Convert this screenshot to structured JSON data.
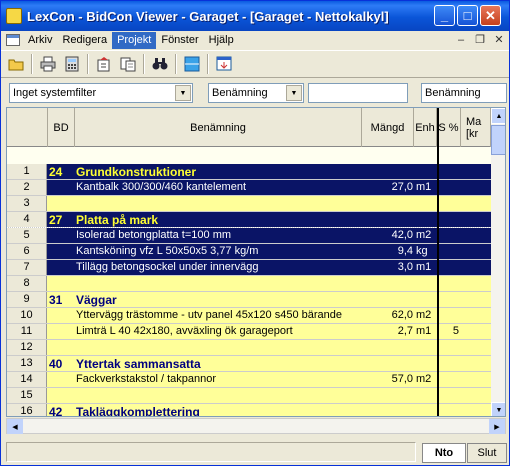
{
  "window": {
    "title": "LexCon - BidCon Viewer - Garaget - [Garaget - Nettokalkyl]",
    "min": "0",
    "max": "1",
    "close": "r"
  },
  "menu": [
    "Arkiv",
    "Redigera",
    "Projekt",
    "Fönster",
    "Hjälp"
  ],
  "menu_active": "Projekt",
  "mdi": {
    "min": "–",
    "restore": "❐",
    "close": "✕"
  },
  "toolbar": [
    "open-folder-icon",
    "print-icon",
    "calculator-icon",
    "export-icon",
    "copy-icon",
    "binoculars-icon",
    "layout-icon",
    "window-icon"
  ],
  "filter": {
    "system": "Inget systemfilter",
    "sort": "Benämning",
    "search": "",
    "column": "Benämning"
  },
  "columns": {
    "bd": "BD",
    "benamning": "Benämning",
    "mangd": "Mängd",
    "enh": "Enh",
    "spct": "S %",
    "ma_line1": "Ma",
    "ma_line2": "[kr"
  },
  "rows": [
    {
      "n": "1",
      "bd": "24",
      "text": "Grundkonstruktioner",
      "mangd": "",
      "enh": "",
      "s": "",
      "type": "group"
    },
    {
      "n": "2",
      "bd": "",
      "text": "Kantbalk 300/300/460 kantelement",
      "mangd": "27,0",
      "enh": "m1",
      "s": "",
      "type": "hilite"
    },
    {
      "n": "3",
      "bd": "",
      "text": "",
      "mangd": "",
      "enh": "",
      "s": "",
      "type": "item"
    },
    {
      "n": "4",
      "bd": "27",
      "text": "Platta på mark",
      "mangd": "",
      "enh": "",
      "s": "",
      "type": "group"
    },
    {
      "n": "5",
      "bd": "",
      "text": "Isolerad betongplatta t=100 mm",
      "mangd": "42,0",
      "enh": "m2",
      "s": "",
      "type": "selected"
    },
    {
      "n": "6",
      "bd": "",
      "text": "Kantsköning vfz L 50x50x5 3,77 kg/m",
      "mangd": "9,4",
      "enh": "kg",
      "s": "",
      "type": "hilite"
    },
    {
      "n": "7",
      "bd": "",
      "text": "Tillägg betongsockel under innervägg",
      "mangd": "3,0",
      "enh": "m1",
      "s": "",
      "type": "hilite"
    },
    {
      "n": "8",
      "bd": "",
      "text": "",
      "mangd": "",
      "enh": "",
      "s": "",
      "type": "item"
    },
    {
      "n": "9",
      "bd": "31",
      "text": "Väggar",
      "mangd": "",
      "enh": "",
      "s": "",
      "type": "header"
    },
    {
      "n": "10",
      "bd": "",
      "text": "Yttervägg trästomme - utv panel 45x120 s450 bärande",
      "mangd": "62,0",
      "enh": "m2",
      "s": "",
      "type": "item"
    },
    {
      "n": "11",
      "bd": "",
      "text": "Limträ L 40 42x180, avväxling ök garageport",
      "mangd": "2,7",
      "enh": "m1",
      "s": "5",
      "type": "item"
    },
    {
      "n": "12",
      "bd": "",
      "text": "",
      "mangd": "",
      "enh": "",
      "s": "",
      "type": "item"
    },
    {
      "n": "13",
      "bd": "40",
      "text": "Yttertak sammansatta",
      "mangd": "",
      "enh": "",
      "s": "",
      "type": "header"
    },
    {
      "n": "14",
      "bd": "",
      "text": "Fackverkstakstol / takpannor",
      "mangd": "57,0",
      "enh": "m2",
      "s": "",
      "type": "item"
    },
    {
      "n": "15",
      "bd": "",
      "text": "",
      "mangd": "",
      "enh": "",
      "s": "",
      "type": "item"
    },
    {
      "n": "16",
      "bd": "42",
      "text": "Takläggkomplettering",
      "mangd": "",
      "enh": "",
      "s": "",
      "type": "header"
    }
  ],
  "status": {
    "tab_nto": "Nto",
    "tab_slut": "Slut"
  }
}
